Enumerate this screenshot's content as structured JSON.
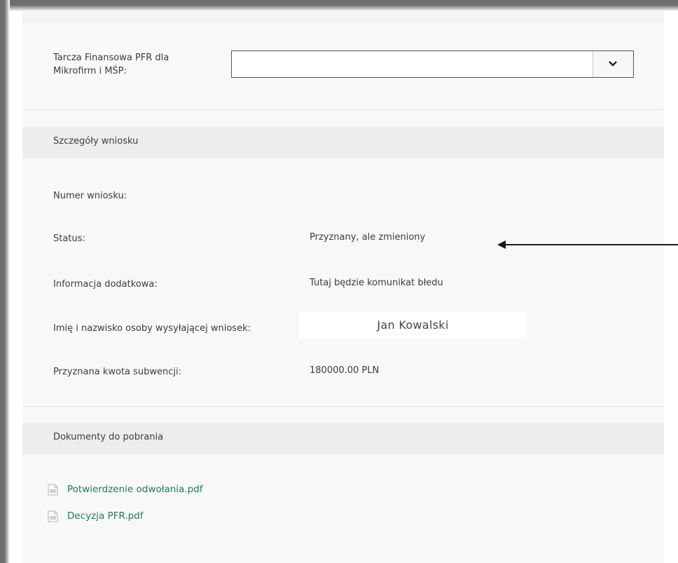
{
  "shield_field": {
    "label": "Tarcza Finansowa PFR dla Mikrofirm i MŚP:",
    "selected_value": ""
  },
  "details_section": {
    "header": "Szczegóły wniosku",
    "rows": [
      {
        "label": "Numer wniosku:",
        "value": ""
      },
      {
        "label": "Status:",
        "value": "Przyznany, ale zmieniony"
      },
      {
        "label": "Informacja dodatkowa:",
        "value": "Tutaj będzie komunikat błedu"
      },
      {
        "label": "Imię i nazwisko osoby wysyłającej wniosek:",
        "value": "Jan Kowalski"
      },
      {
        "label": "Przyznana kwota subwencji:",
        "value": "180000.00 PLN"
      }
    ]
  },
  "documents_section": {
    "header": "Dokumenty do pobrania",
    "files": [
      {
        "name": "Potwierdzenie odwołania.pdf",
        "icon": "pdf-file-icon"
      },
      {
        "name": "Decyzja PFR.pdf",
        "icon": "pdf-file-icon"
      }
    ]
  },
  "colors": {
    "link": "#1e7e4a",
    "section_header_bg": "#ededed",
    "panel_bg": "#f8f8f8"
  }
}
